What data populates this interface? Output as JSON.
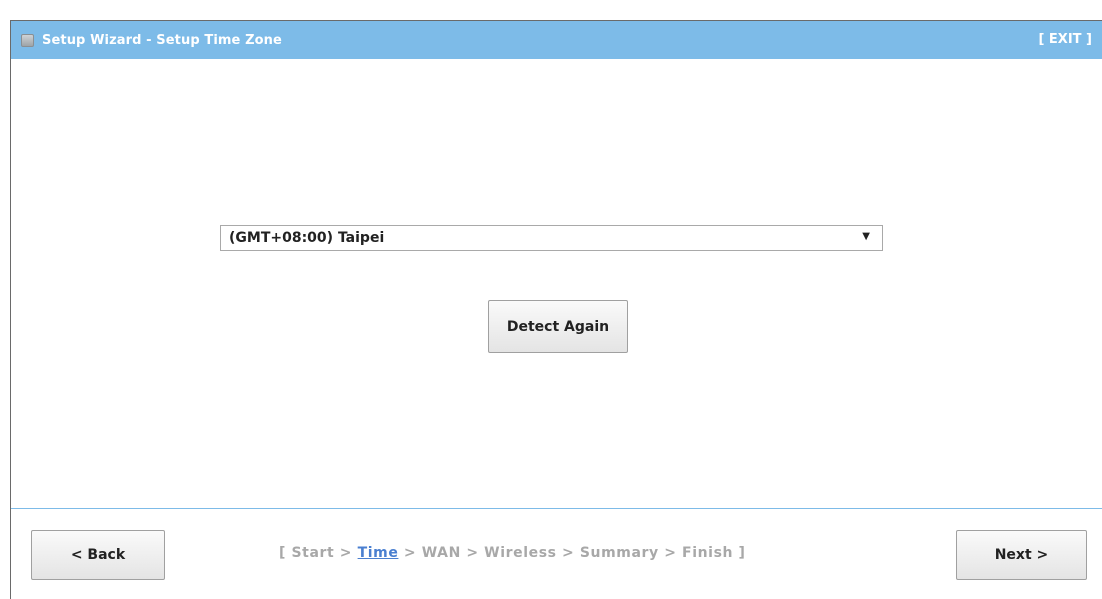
{
  "window": {
    "title": "Setup Wizard - Setup Time Zone",
    "exit_label": "[ EXIT ]"
  },
  "timezone": {
    "selected": "(GMT+08:00) Taipei",
    "arrow": "▼"
  },
  "detect_button": {
    "label": "Detect Again"
  },
  "footer": {
    "back_label": "< Back",
    "next_label": "Next >",
    "steps": {
      "open": "[ ",
      "start": "Start",
      "sep": " > ",
      "time": "Time",
      "wan": "WAN",
      "wireless": "Wireless",
      "summary": "Summary",
      "finish": "Finish",
      "close": " ]"
    }
  },
  "colors": {
    "title_bar": "#7dbbe8",
    "current_step": "#4a7fd0",
    "inactive_step": "#a8a8a8"
  }
}
